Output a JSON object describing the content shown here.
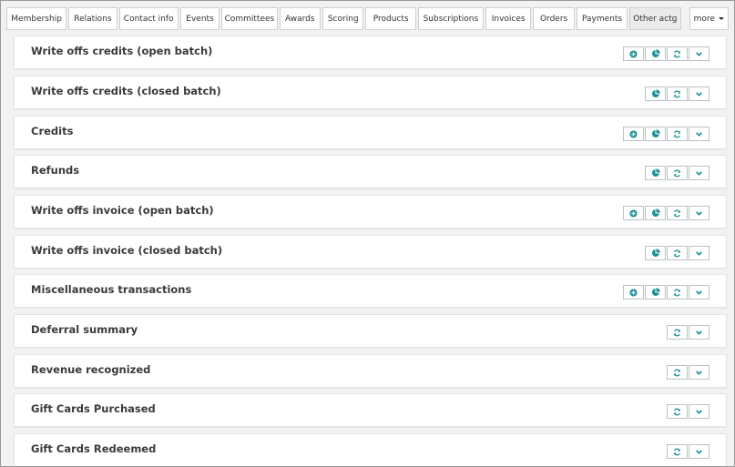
{
  "tabs": [
    {
      "label": "Membership",
      "w": 67
    },
    {
      "label": "Relations",
      "w": 54
    },
    {
      "label": "Contact info",
      "w": 66
    },
    {
      "label": "Events",
      "w": 44
    },
    {
      "label": "Committees",
      "w": 62
    },
    {
      "label": "Awards",
      "w": 46
    },
    {
      "label": "Scoring",
      "w": 46
    },
    {
      "label": "Products",
      "w": 56
    },
    {
      "label": "Subscriptions",
      "w": 73
    },
    {
      "label": "Invoices",
      "w": 51
    },
    {
      "label": "Orders",
      "w": 46
    },
    {
      "label": "Payments",
      "w": 57
    },
    {
      "label": "Other actg",
      "w": 57,
      "active": true
    }
  ],
  "more_label": "more",
  "panels": [
    {
      "title": "Write offs credits (open batch)",
      "actions": [
        "add",
        "report",
        "refresh",
        "expand"
      ]
    },
    {
      "title": "Write offs credits (closed batch)",
      "actions": [
        "report",
        "refresh",
        "expand"
      ]
    },
    {
      "title": "Credits",
      "actions": [
        "add",
        "report",
        "refresh",
        "expand"
      ]
    },
    {
      "title": "Refunds",
      "actions": [
        "report",
        "refresh",
        "expand"
      ]
    },
    {
      "title": "Write offs invoice (open batch)",
      "actions": [
        "add",
        "report",
        "refresh",
        "expand"
      ]
    },
    {
      "title": "Write offs invoice (closed batch)",
      "actions": [
        "report",
        "refresh",
        "expand"
      ]
    },
    {
      "title": "Miscellaneous transactions",
      "actions": [
        "add",
        "report",
        "refresh",
        "expand"
      ]
    },
    {
      "title": "Deferral summary",
      "actions": [
        "refresh",
        "expand"
      ]
    },
    {
      "title": "Revenue recognized",
      "actions": [
        "refresh",
        "expand"
      ]
    },
    {
      "title": "Gift Cards Purchased",
      "actions": [
        "refresh",
        "expand"
      ]
    },
    {
      "title": "Gift Cards Redeemed",
      "actions": [
        "refresh",
        "expand"
      ]
    }
  ],
  "icon_names": {
    "add": "plus-circle-icon",
    "report": "pie-chart-icon",
    "refresh": "refresh-icon",
    "expand": "chevron-down-icon"
  },
  "colors": {
    "accent": "#1e8f96"
  }
}
